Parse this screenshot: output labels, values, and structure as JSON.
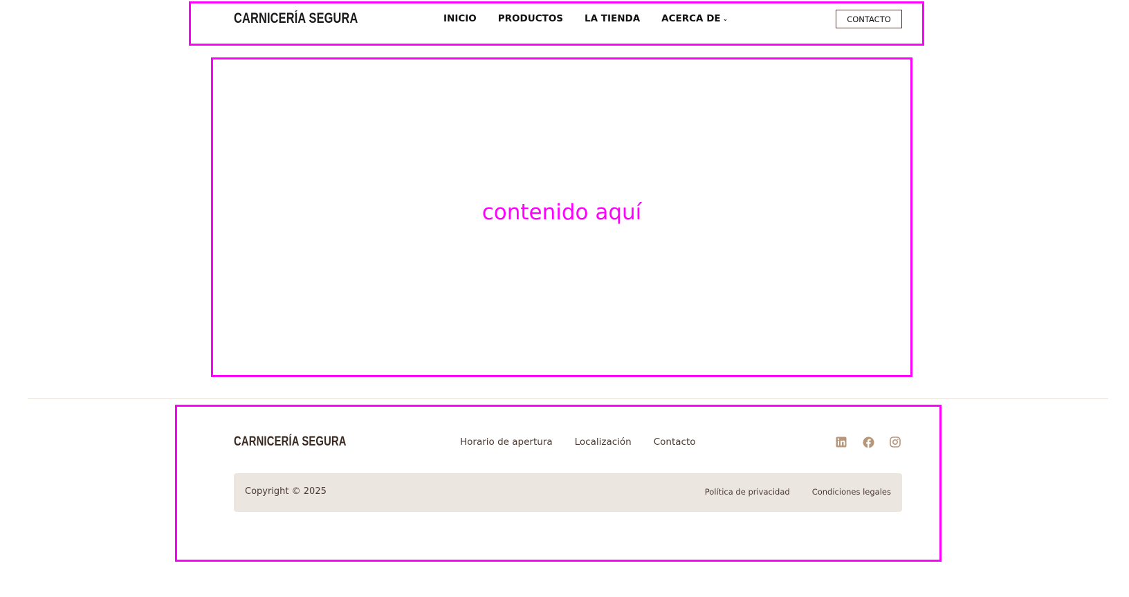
{
  "header": {
    "logo": "CARNICERÍA SEGURA",
    "nav": [
      {
        "label": "INICIO"
      },
      {
        "label": "PRODUCTOS"
      },
      {
        "label": "LA TIENDA"
      },
      {
        "label": "ACERCA DE",
        "dropdown_icon": "chevron-down-icon"
      }
    ],
    "contact_button": "CONTACTO"
  },
  "content": {
    "placeholder": "contenido aquí"
  },
  "footer": {
    "logo": "CARNICERÍA SEGURA",
    "links": [
      {
        "label": "Horario de apertura"
      },
      {
        "label": "Localización"
      },
      {
        "label": "Contacto"
      }
    ],
    "social": [
      {
        "icon": "linkedin-icon"
      },
      {
        "icon": "facebook-icon"
      },
      {
        "icon": "instagram-icon"
      }
    ],
    "copyright": "Copyright © 2025",
    "legal": [
      {
        "label": "Política de privacidad"
      },
      {
        "label": "Condiciones legales"
      }
    ]
  },
  "colors": {
    "annotation_box": "#ff00ff",
    "brand_brown": "#4a3a33",
    "social_icon": "#b8967a",
    "footer_bar_bg": "#ebe6df"
  }
}
